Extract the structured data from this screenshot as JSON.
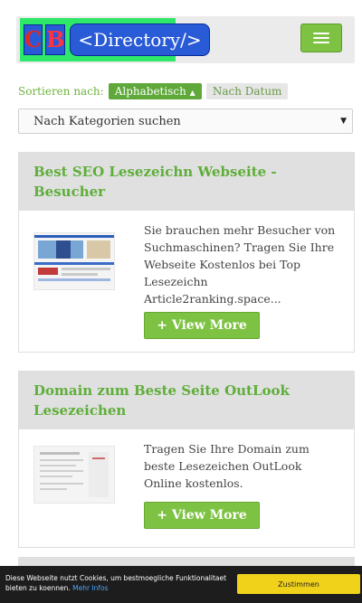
{
  "header": {
    "logo_letters": [
      "C",
      "B"
    ],
    "logo_directory": "<Directory/>"
  },
  "sort": {
    "label": "Sortieren nach:",
    "active": "Alphabetisch",
    "active_arrow": "▲",
    "inactive": "Nach Datum"
  },
  "category_select": {
    "selected": "Nach Kategorien suchen",
    "arrow": "▼"
  },
  "listings": [
    {
      "title": "Best SEO Lesezeichn Webseite - Besucher",
      "description": "Sie brauchen mehr Besucher von Suchmaschinen? Tragen Sie Ihre Webseite Kostenlos bei Top Lesezeichn Article2ranking.space...",
      "button": "+ View More"
    },
    {
      "title": "Domain zum Beste Seite OutLook Lesezeichen",
      "description": "Tragen Sie Ihre Domain zum beste Lesezeichen OutLook Online kostenlos.",
      "button": "+ View More"
    }
  ],
  "cookie": {
    "text": "Diese Webseite nutzt Cookies, um bestmoegliche Funktionalitaet bieten zu koennen.",
    "link": "Mehr Infos",
    "accept": "Zustimmen"
  },
  "colors": {
    "accent_green": "#7dc243",
    "title_green": "#5fae3a",
    "logo_bg": "#2ee86a",
    "logo_blue": "#2a5bd7",
    "cookie_bg": "#1d1d1d",
    "cookie_button": "#f1d21b"
  }
}
